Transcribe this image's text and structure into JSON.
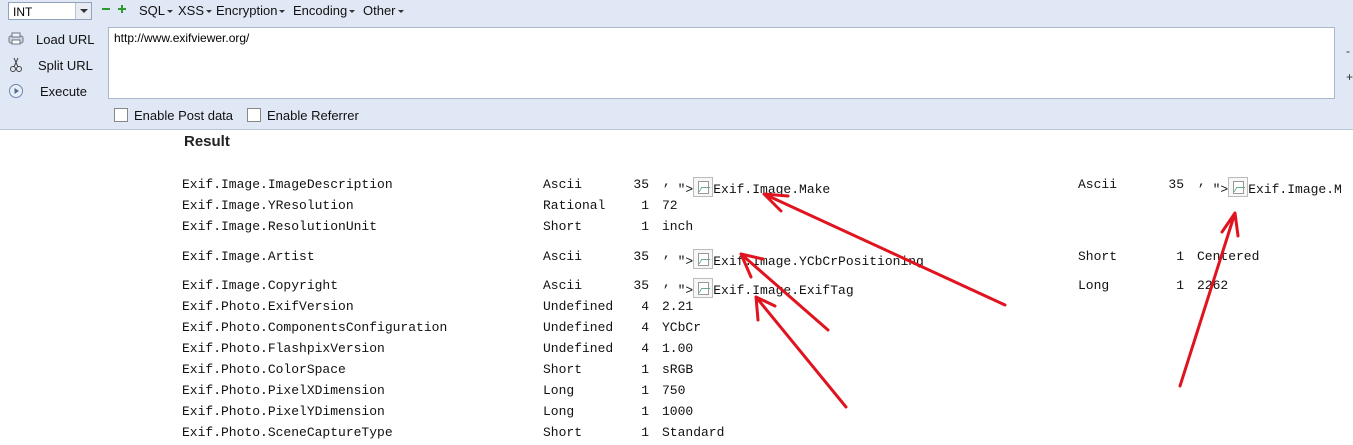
{
  "toolbar": {
    "select_value": "INT",
    "menus": [
      "SQL",
      "XSS",
      "Encryption",
      "Encoding",
      "Other"
    ],
    "buttons": {
      "load": "Load URL",
      "split": "Split URL",
      "execute": "Execute"
    },
    "url": "http://www.exifviewer.org/",
    "checkboxes": {
      "post": "Enable Post data",
      "referrer": "Enable Referrer"
    },
    "colors": {
      "background": "#dfe8f4",
      "add_remove": "#2f9a2f"
    }
  },
  "result": {
    "heading": "Result",
    "injected": "’ \">",
    "rows": [
      {
        "key": "Exif.Image.ImageDescription",
        "type": "Ascii",
        "count": "35",
        "has_img": true,
        "value": "Exif.Image.Make",
        "type2": "Ascii",
        "count2": "35",
        "value2": "’ \">",
        "has_img2": true,
        "value3": "Exif.Image.M"
      },
      {
        "key": "Exif.Image.YResolution",
        "type": "Rational",
        "count": "1",
        "value": "72"
      },
      {
        "key": "Exif.Image.ResolutionUnit",
        "type": "Short",
        "count": "1",
        "value": "inch"
      },
      {
        "key": "Exif.Image.Artist",
        "type": "Ascii",
        "count": "35",
        "has_img": true,
        "value": "Exif.Image.YCbCrPositioning",
        "type2": "Short",
        "count2": "1",
        "value2": "Centered"
      },
      {
        "key": "Exif.Image.Copyright",
        "type": "Ascii",
        "count": "35",
        "has_img": true,
        "value": "Exif.Image.ExifTag",
        "type2": "Long",
        "count2": "1",
        "value2": "2262"
      },
      {
        "key": "Exif.Photo.ExifVersion",
        "type": "Undefined",
        "count": "4",
        "value": "2.21"
      },
      {
        "key": "Exif.Photo.ComponentsConfiguration",
        "type": "Undefined",
        "count": "4",
        "value": "YCbCr"
      },
      {
        "key": "Exif.Photo.FlashpixVersion",
        "type": "Undefined",
        "count": "4",
        "value": "1.00"
      },
      {
        "key": "Exif.Photo.ColorSpace",
        "type": "Short",
        "count": "1",
        "value": "sRGB"
      },
      {
        "key": "Exif.Photo.PixelXDimension",
        "type": "Long",
        "count": "1",
        "value": "750"
      },
      {
        "key": "Exif.Photo.PixelYDimension",
        "type": "Long",
        "count": "1",
        "value": "1000"
      },
      {
        "key": "Exif.Photo.SceneCaptureType",
        "type": "Short",
        "count": "1",
        "value": "Standard"
      }
    ]
  },
  "annotation": {
    "arrow_color": "#e0141e"
  }
}
